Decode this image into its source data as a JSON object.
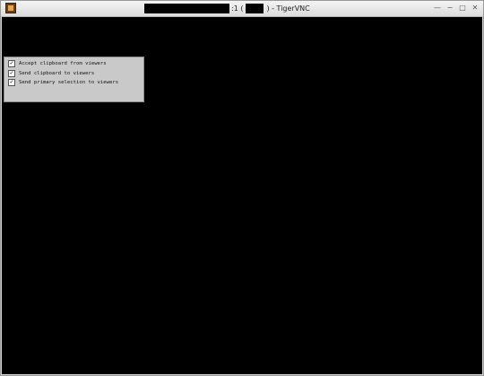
{
  "window": {
    "title_suffix": ":1 (",
    "title_app": ") - TigerVNC",
    "controls": [
      "—",
      "−",
      "□",
      "✕"
    ]
  },
  "clipboard_panel": {
    "options": [
      {
        "label": "Accept clipboard from viewers",
        "checked": true,
        "mark": "✓"
      },
      {
        "label": "Send clipboard to viewers",
        "checked": true,
        "mark": "✓"
      },
      {
        "label": "Send primary selection to viewers",
        "checked": true,
        "mark": "✓"
      }
    ]
  },
  "icons": {
    "app": "tigervnc-app-icon"
  },
  "colors": {
    "viewport": "#000000",
    "panel": "#c9c9c9"
  }
}
